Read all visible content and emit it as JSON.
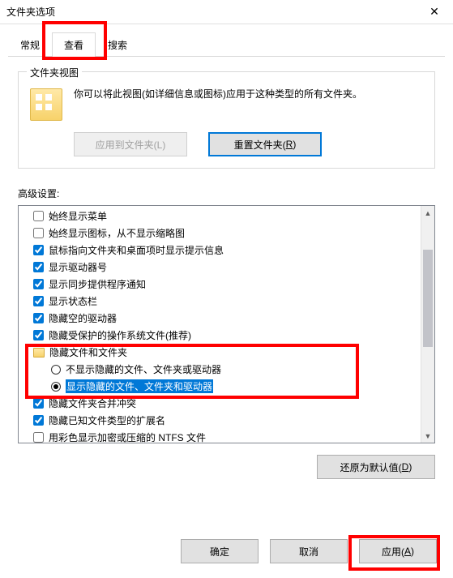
{
  "window": {
    "title": "文件夹选项",
    "close_glyph": "✕"
  },
  "tabs": {
    "general": "常规",
    "view": "查看",
    "search": "搜索"
  },
  "folder_views": {
    "legend": "文件夹视图",
    "description": "你可以将此视图(如详细信息或图标)应用于这种类型的所有文件夹。",
    "apply_to_folders": "应用到文件夹(L)",
    "reset_folders_prefix": "重置文件夹(",
    "reset_folders_key": "R",
    "reset_folders_suffix": ")"
  },
  "advanced": {
    "label": "高级设置:",
    "items": [
      {
        "kind": "check",
        "checked": false,
        "label": "始终显示菜单"
      },
      {
        "kind": "check",
        "checked": false,
        "label": "始终显示图标，从不显示缩略图"
      },
      {
        "kind": "check",
        "checked": true,
        "label": "鼠标指向文件夹和桌面项时显示提示信息"
      },
      {
        "kind": "check",
        "checked": true,
        "label": "显示驱动器号"
      },
      {
        "kind": "check",
        "checked": true,
        "label": "显示同步提供程序通知"
      },
      {
        "kind": "check",
        "checked": true,
        "label": "显示状态栏"
      },
      {
        "kind": "check",
        "checked": true,
        "label": "隐藏空的驱动器"
      },
      {
        "kind": "check",
        "checked": true,
        "label": "隐藏受保护的操作系统文件(推荐)"
      },
      {
        "kind": "folder",
        "label": "隐藏文件和文件夹"
      },
      {
        "kind": "radio",
        "checked": false,
        "label": "不显示隐藏的文件、文件夹或驱动器"
      },
      {
        "kind": "radio",
        "checked": true,
        "label": "显示隐藏的文件、文件夹和驱动器",
        "selected": true
      },
      {
        "kind": "check",
        "checked": true,
        "label": "隐藏文件夹合并冲突"
      },
      {
        "kind": "check",
        "checked": true,
        "label": "隐藏已知文件类型的扩展名"
      },
      {
        "kind": "check",
        "checked": false,
        "label": "用彩色显示加密或压缩的 NTFS 文件"
      }
    ]
  },
  "buttons": {
    "restore_defaults_prefix": "还原为默认值(",
    "restore_defaults_key": "D",
    "restore_defaults_suffix": ")",
    "ok": "确定",
    "cancel": "取消",
    "apply_prefix": "应用(",
    "apply_key": "A",
    "apply_suffix": ")"
  }
}
